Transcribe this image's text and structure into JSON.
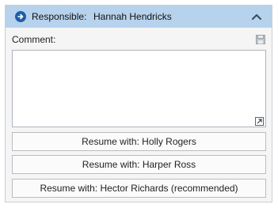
{
  "header": {
    "label": "Responsible:",
    "name": "Hannah Hendricks",
    "arrow_icon": "arrow-right-circle-icon",
    "collapse_icon": "chevron-up-icon"
  },
  "comment": {
    "label": "Comment:",
    "value": "",
    "save_icon": "save-icon",
    "expand_icon": "expand-icon"
  },
  "actions": [
    {
      "label": "Resume with: Holly Rogers"
    },
    {
      "label": "Resume with: Harper Ross"
    },
    {
      "label": "Resume with: Hector Richards (recommended)"
    }
  ],
  "colors": {
    "header_bg": "#b6d2ec",
    "accent": "#1d5ea8"
  }
}
